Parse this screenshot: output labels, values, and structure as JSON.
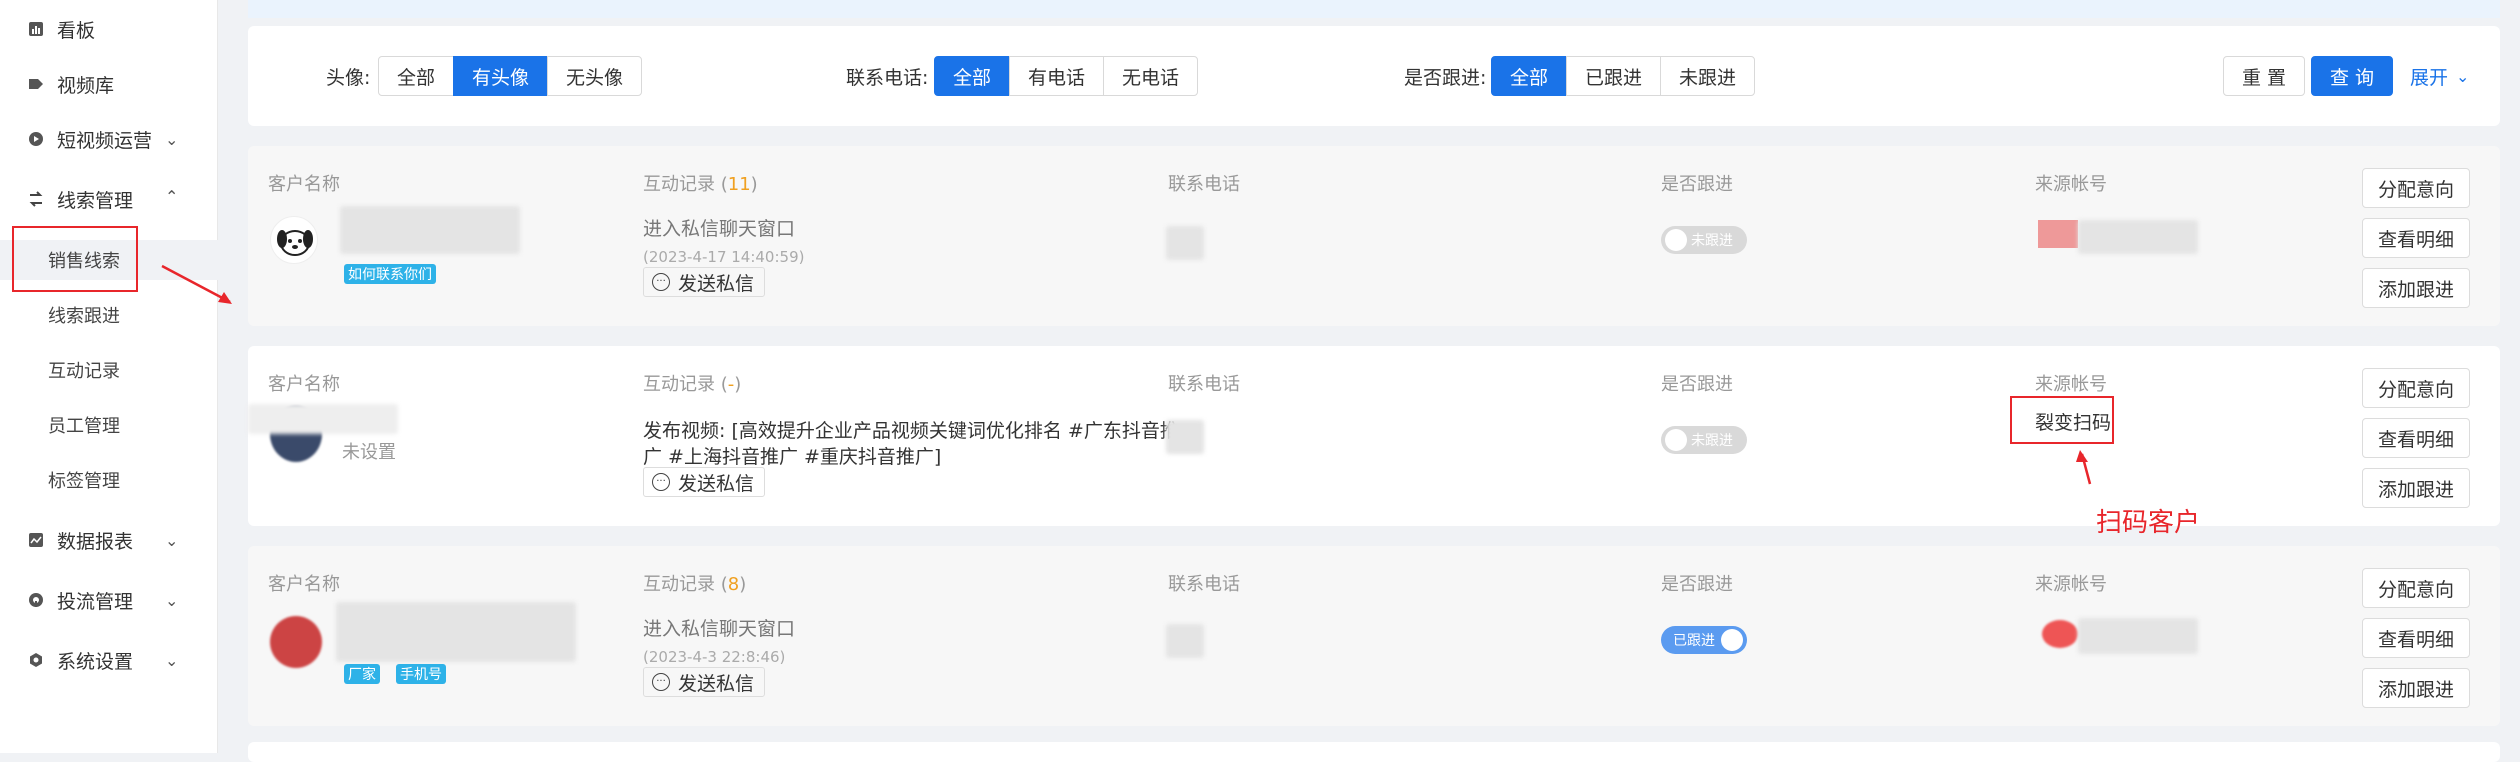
{
  "sidebar": {
    "items": [
      {
        "label": "看板",
        "icon": "bar-chart-icon"
      },
      {
        "label": "视频库",
        "icon": "tag-icon"
      },
      {
        "label": "短视频运营",
        "icon": "play-circle-icon"
      },
      {
        "label": "线索管理",
        "icon": "flow-icon"
      },
      {
        "label": "数据报表",
        "icon": "line-chart-icon"
      },
      {
        "label": "投流管理",
        "icon": "rocket-icon"
      },
      {
        "label": "系统设置",
        "icon": "gear-icon"
      }
    ],
    "sub_items": [
      "销售线索",
      "线索跟进",
      "互动记录",
      "员工管理",
      "标签管理"
    ]
  },
  "filters": {
    "avatar": {
      "label": "头像:",
      "options": [
        "全部",
        "有头像",
        "无头像"
      ],
      "selected": "有头像"
    },
    "phone": {
      "label": "联系电话:",
      "options": [
        "全部",
        "有电话",
        "无电话"
      ],
      "selected": "全部"
    },
    "follow": {
      "label": "是否跟进:",
      "options": [
        "全部",
        "已跟进",
        "未跟进"
      ],
      "selected": "全部"
    },
    "reset_label": "重 置",
    "query_label": "查 询",
    "expand_label": "展开"
  },
  "columns": {
    "customer": "客户名称",
    "interaction": "互动记录",
    "phone": "联系电话",
    "follow": "是否跟进",
    "source": "来源帐号"
  },
  "rows": [
    {
      "interaction_count": "11",
      "tags": [
        "如何联系你们"
      ],
      "record": "进入私信聊天窗口",
      "record_time": "(2023-4-17 14:40:59)",
      "follow_state": "未跟进",
      "followed": false,
      "source": ""
    },
    {
      "interaction_count": "-",
      "name_sub": "未设置",
      "record_line1": "发布视频: [高效提升企业产品视频关键词优化排名 #广东抖音推",
      "record_line2": "广 #上海抖音推广 #重庆抖音推广]",
      "follow_state": "未跟进",
      "followed": false,
      "source": "裂变扫码"
    },
    {
      "interaction_count": "8",
      "tags": [
        "厂家",
        "手机号"
      ],
      "record": "进入私信聊天窗口",
      "record_time": "(2023-4-3 22:8:46)",
      "follow_state": "已跟进",
      "followed": true,
      "source": ""
    }
  ],
  "row_actions": [
    "分配意向",
    "查看明细",
    "添加跟进"
  ],
  "send_dm_label": "发送私信",
  "annotation": "扫码客户",
  "colors": {
    "primary": "#1a73e8",
    "annotation": "#e8262b",
    "tag": "#2eb2e8"
  }
}
